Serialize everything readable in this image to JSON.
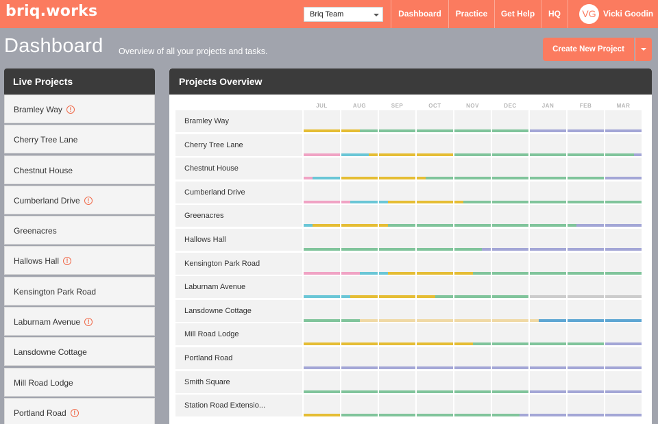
{
  "app": {
    "logo": "briq.works"
  },
  "header": {
    "team_select": "Briq Team",
    "nav": [
      "Dashboard",
      "Practice",
      "Get Help",
      "HQ"
    ],
    "user": {
      "initials": "VG",
      "name": "Vicki Goodin"
    }
  },
  "page": {
    "title": "Dashboard",
    "subtitle": "Overview of all your projects and tasks.",
    "create_button": "Create New Project"
  },
  "live_projects": {
    "title": "Live Projects",
    "items": [
      {
        "name": "Bramley Way",
        "alert": true
      },
      {
        "name": "Cherry Tree Lane",
        "alert": false
      },
      {
        "name": "Chestnut House",
        "alert": false
      },
      {
        "name": "Cumberland Drive",
        "alert": true
      },
      {
        "name": "Greenacres",
        "alert": false
      },
      {
        "name": "Hallows Hall",
        "alert": true
      },
      {
        "name": "Kensington Park Road",
        "alert": false
      },
      {
        "name": "Laburnam Avenue",
        "alert": true
      },
      {
        "name": "Lansdowne Cottage",
        "alert": false
      },
      {
        "name": "Mill Road Lodge",
        "alert": false
      },
      {
        "name": "Portland Road",
        "alert": true
      }
    ]
  },
  "overview": {
    "title": "Projects Overview",
    "months": [
      "JUL",
      "AUG",
      "SEP",
      "OCT",
      "NOV",
      "DEC",
      "JAN",
      "FEB",
      "MAR"
    ],
    "colors": {
      "pink": "#f0a3c4",
      "teal": "#6ac6d6",
      "yellow": "#e5bd34",
      "green": "#80c49b",
      "purple": "#a3a6d6",
      "tan": "#f0d9a5",
      "grey": "#cccccc",
      "blue": "#5da6d3"
    },
    "rows": [
      {
        "name": "Bramley Way",
        "segments": [
          [
            "yellow",
            0,
            1
          ],
          [
            "yellow",
            1,
            1.5
          ],
          [
            "green",
            1.5,
            6
          ],
          [
            "purple",
            6,
            9
          ]
        ]
      },
      {
        "name": "Cherry Tree Lane",
        "segments": [
          [
            "pink",
            0,
            1
          ],
          [
            "teal",
            1,
            1.75
          ],
          [
            "yellow",
            1.75,
            4
          ],
          [
            "green",
            4,
            8.8
          ],
          [
            "purple",
            8.8,
            9
          ]
        ]
      },
      {
        "name": "Chestnut House",
        "segments": [
          [
            "pink",
            0,
            0.25
          ],
          [
            "teal",
            0.25,
            1
          ],
          [
            "yellow",
            1,
            3.25
          ],
          [
            "green",
            3.25,
            8
          ],
          [
            "purple",
            8,
            9
          ]
        ]
      },
      {
        "name": "Cumberland Drive",
        "segments": [
          [
            "pink",
            0,
            1.25
          ],
          [
            "teal",
            1.25,
            2.25
          ],
          [
            "yellow",
            2.25,
            4.25
          ],
          [
            "green",
            4.25,
            9
          ]
        ]
      },
      {
        "name": "Greenacres",
        "segments": [
          [
            "teal",
            0,
            0.25
          ],
          [
            "yellow",
            0.25,
            2.25
          ],
          [
            "green",
            2.25,
            7.25
          ],
          [
            "purple",
            7.25,
            9
          ]
        ]
      },
      {
        "name": "Hallows Hall",
        "segments": [
          [
            "green",
            0,
            4.75
          ],
          [
            "purple",
            4.75,
            9
          ]
        ]
      },
      {
        "name": "Kensington Park Road",
        "segments": [
          [
            "pink",
            0,
            1.5
          ],
          [
            "teal",
            1.5,
            2.25
          ],
          [
            "yellow",
            2.25,
            4.5
          ],
          [
            "green",
            4.5,
            9
          ]
        ]
      },
      {
        "name": "Laburnam Avenue",
        "segments": [
          [
            "teal",
            0,
            1.25
          ],
          [
            "yellow",
            1.25,
            3.5
          ],
          [
            "green",
            3.5,
            6
          ],
          [
            "grey",
            6,
            9
          ]
        ]
      },
      {
        "name": "Lansdowne Cottage",
        "segments": [
          [
            "green",
            0,
            1.5
          ],
          [
            "tan",
            1.5,
            6.25
          ],
          [
            "blue",
            6.25,
            9
          ]
        ]
      },
      {
        "name": "Mill Road Lodge",
        "segments": [
          [
            "yellow",
            0,
            4.5
          ],
          [
            "green",
            4.5,
            8
          ],
          [
            "purple",
            8,
            9
          ]
        ]
      },
      {
        "name": "Portland Road",
        "segments": [
          [
            "purple",
            0,
            9
          ]
        ]
      },
      {
        "name": "Smith Square",
        "segments": [
          [
            "green",
            0,
            6
          ],
          [
            "purple",
            6,
            9
          ]
        ]
      },
      {
        "name": "Station Road Extensio...",
        "segments": [
          [
            "yellow",
            0,
            1
          ],
          [
            "green",
            1,
            5.75
          ],
          [
            "purple",
            5.75,
            9
          ]
        ]
      }
    ]
  }
}
